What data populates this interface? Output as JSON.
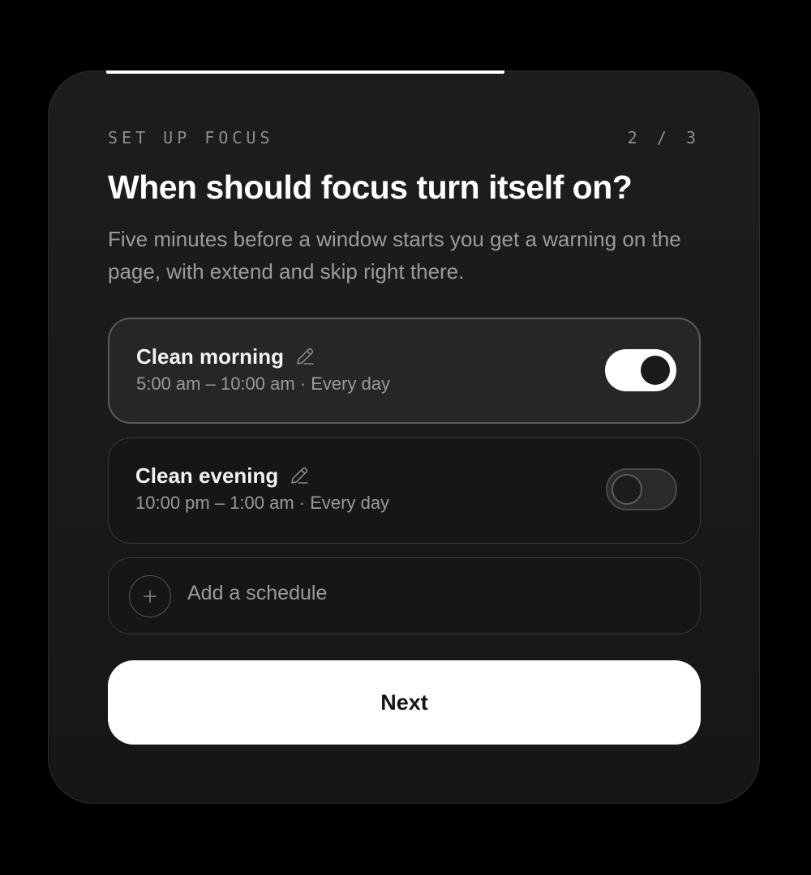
{
  "onboarding": {
    "eyebrow": "SET UP FOCUS",
    "step_counter": "2 / 3",
    "progress": {
      "current_step": 2,
      "total_steps": 3,
      "fraction": 0.667
    },
    "title": "When should focus turn itself on?",
    "subtitle": "Five minutes before a window starts you get a warning on the page, with extend and skip right there."
  },
  "schedules": [
    {
      "name": "Clean morning",
      "time": "5:00 am – 10:00 am · Every day",
      "enabled": true,
      "edit_icon": "pencil-icon"
    },
    {
      "name": "Clean evening",
      "time": "10:00 pm – 1:00 am · Every day",
      "enabled": false,
      "edit_icon": "pencil-icon"
    }
  ],
  "add_schedule": {
    "label": "Add a schedule",
    "icon": "plus-icon"
  },
  "actions": {
    "next_label": "Next"
  },
  "colors": {
    "background": "#000000",
    "card": "#1b1b1b",
    "accent": "#ffffff",
    "muted_text": "#9a9a9a"
  }
}
